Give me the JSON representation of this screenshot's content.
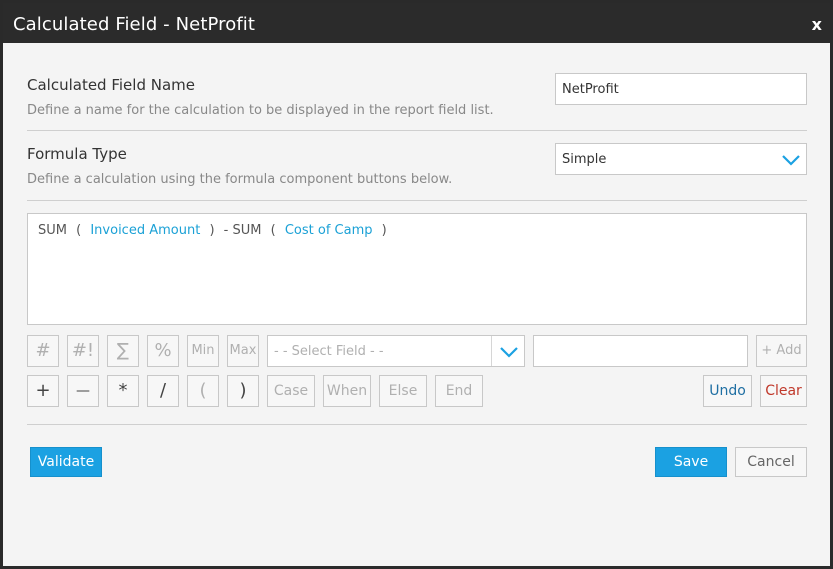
{
  "dialog": {
    "title": "Calculated Field - NetProfit",
    "close_label": "x"
  },
  "name_section": {
    "label": "Calculated Field Name",
    "description": "Define a name for the calculation to be displayed in the report field list.",
    "value": "NetProfit"
  },
  "formula_type_section": {
    "label": "Formula Type",
    "description": "Define a calculation using the formula component buttons below.",
    "selected": "Simple"
  },
  "formula": {
    "tokens": [
      {
        "text": "SUM",
        "kind": "func"
      },
      {
        "text": "(",
        "kind": "paren"
      },
      {
        "text": "Invoiced Amount",
        "kind": "field"
      },
      {
        "text": ")",
        "kind": "paren"
      },
      {
        "text": "- SUM",
        "kind": "func"
      },
      {
        "text": "(",
        "kind": "paren"
      },
      {
        "text": "Cost of Camp",
        "kind": "field"
      },
      {
        "text": ")",
        "kind": "paren"
      }
    ]
  },
  "toolbar_row1": {
    "number_btn": "#",
    "number_bang_btn": "#!",
    "sum_btn": "∑",
    "percent_btn": "%",
    "min_btn": "Min",
    "max_btn": "Max",
    "field_select_placeholder": "- - Select Field - -",
    "value_input": "",
    "add_btn": "+ Add"
  },
  "toolbar_row2": {
    "plus_btn": "+",
    "minus_btn": "—",
    "multiply_btn": "*",
    "divide_btn": "/",
    "open_paren_btn": "(",
    "close_paren_btn": ")",
    "case_btn": "Case",
    "when_btn": "When",
    "else_btn": "Else",
    "end_btn": "End",
    "undo_btn": "Undo",
    "clear_btn": "Clear"
  },
  "footer": {
    "validate_btn": "Validate",
    "save_btn": "Save",
    "cancel_btn": "Cancel"
  },
  "colors": {
    "accent": "#1ba1e2",
    "field_token": "#1ba1d6",
    "undo": "#1f6fa3",
    "clear": "#c0392b"
  }
}
